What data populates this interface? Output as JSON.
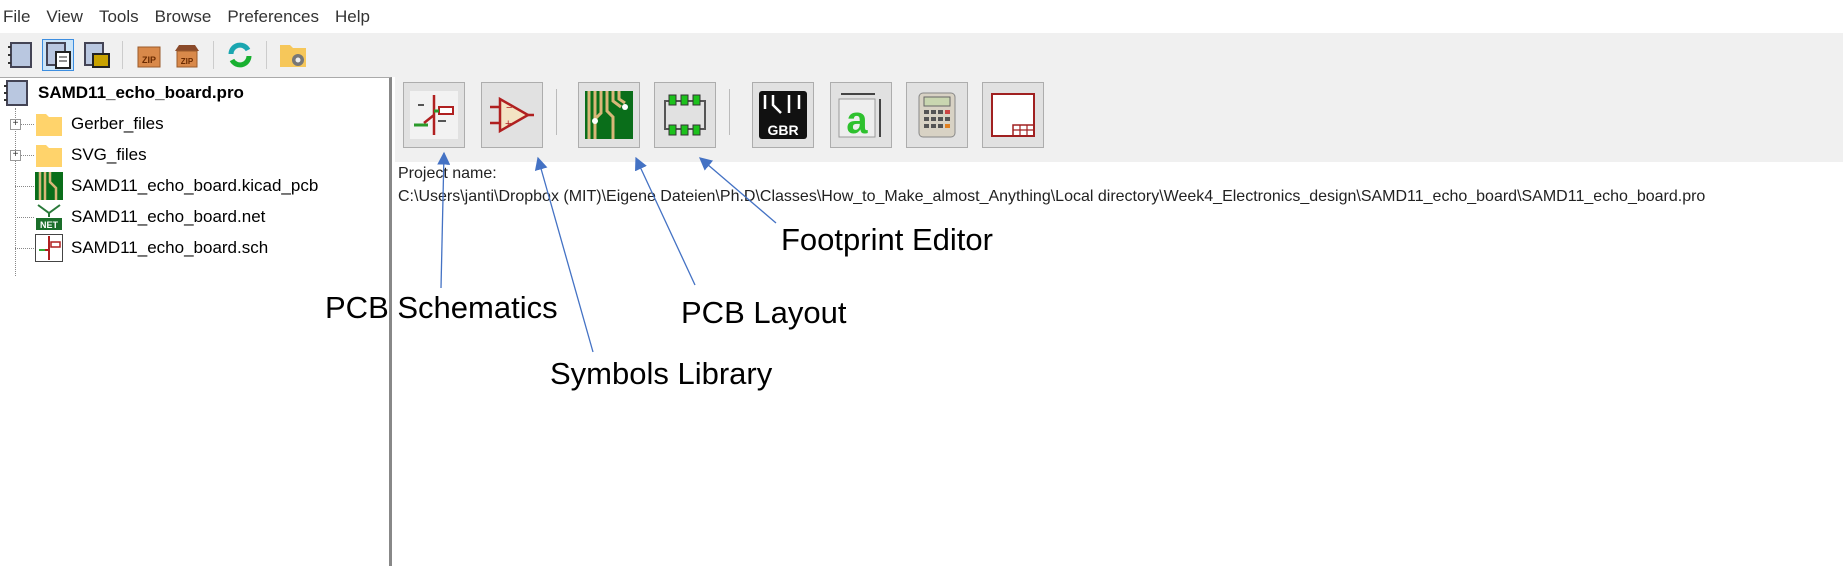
{
  "menu": [
    "File",
    "View",
    "Tools",
    "Browse",
    "Preferences",
    "Help"
  ],
  "toolbar": {
    "icons": [
      "new-project-icon",
      "new-project-from-template-icon",
      "open-project-icon",
      "archive-zip-icon",
      "unarchive-zip-icon",
      "refresh-icon",
      "project-settings-folder-icon"
    ],
    "zip_label": "ZIP"
  },
  "tree": {
    "root": "SAMD11_echo_board.pro",
    "items": [
      {
        "label": "Gerber_files",
        "icon": "folder-icon"
      },
      {
        "label": "SVG_files",
        "icon": "folder-icon"
      },
      {
        "label": "SAMD11_echo_board.kicad_pcb",
        "icon": "pcb-file-icon"
      },
      {
        "label": "SAMD11_echo_board.net",
        "icon": "netlist-file-icon"
      },
      {
        "label": "SAMD11_echo_board.sch",
        "icon": "schematic-file-icon"
      }
    ],
    "net_badge": "NET"
  },
  "launcher": {
    "gbr_label": "GBR",
    "buttons": [
      "schematic-editor",
      "symbol-library-editor",
      "pcb-layout-editor",
      "footprint-editor",
      "gerber-viewer",
      "bitmap-converter",
      "pcb-calculator",
      "page-layout-editor"
    ]
  },
  "project": {
    "label": "Project name:",
    "path": "C:\\Users\\janti\\Dropbox (MIT)\\Eigene Dateien\\Ph.D\\Classes\\How_to_Make_almost_Anything\\Local directory\\Week4_Electronics_design\\SAMD11_echo_board\\SAMD11_echo_board.pro"
  },
  "annotations": {
    "schematics": "PCB Schematics",
    "symbols": "Symbols Library",
    "layout": "PCB Layout",
    "footprint": "Footprint Editor"
  },
  "colors": {
    "arrow": "#4472c4",
    "folder": "#ffd36b",
    "pcb_green": "#0a6e1a"
  }
}
